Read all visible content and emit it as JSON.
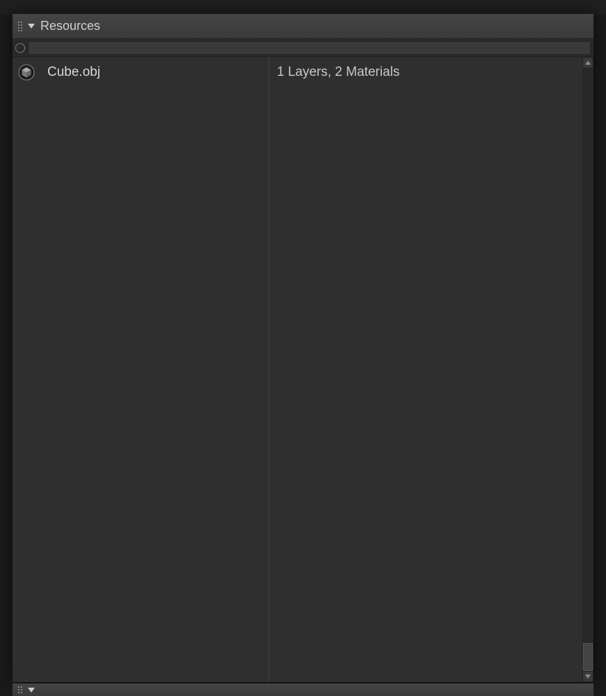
{
  "panel": {
    "title": "Resources",
    "search_value": "",
    "items": [
      {
        "name": "Cube.obj",
        "info": "1 Layers, 2 Materials",
        "icon": "cube"
      }
    ]
  }
}
